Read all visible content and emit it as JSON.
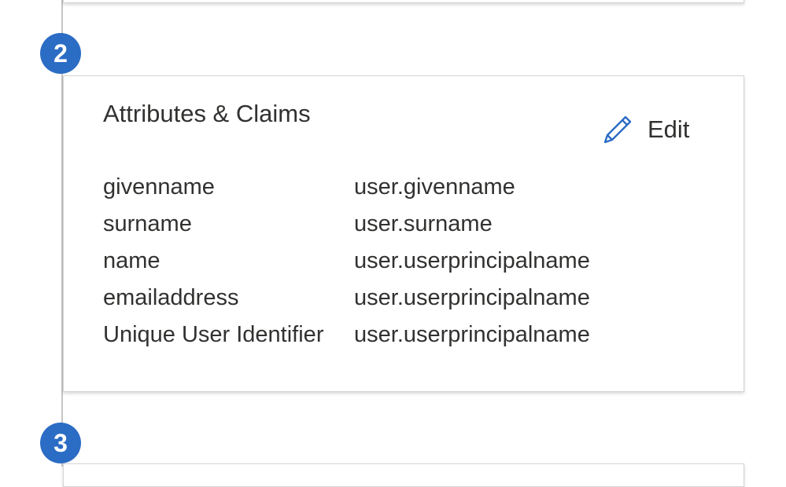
{
  "steps": {
    "step2_number": "2",
    "step3_number": "3"
  },
  "attributes_card": {
    "title": "Attributes & Claims",
    "edit_label": "Edit",
    "edit_icon": "pencil-icon",
    "claims": [
      {
        "name": "givenname",
        "value": "user.givenname"
      },
      {
        "name": "surname",
        "value": "user.surname"
      },
      {
        "name": "name",
        "value": "user.userprincipalname"
      },
      {
        "name": "emailaddress",
        "value": "user.userprincipalname"
      },
      {
        "name": "Unique User Identifier",
        "value": "user.userprincipalname"
      }
    ]
  },
  "colors": {
    "accent": "#2b6cc4",
    "text": "#323130",
    "border": "#d6d5d4"
  }
}
